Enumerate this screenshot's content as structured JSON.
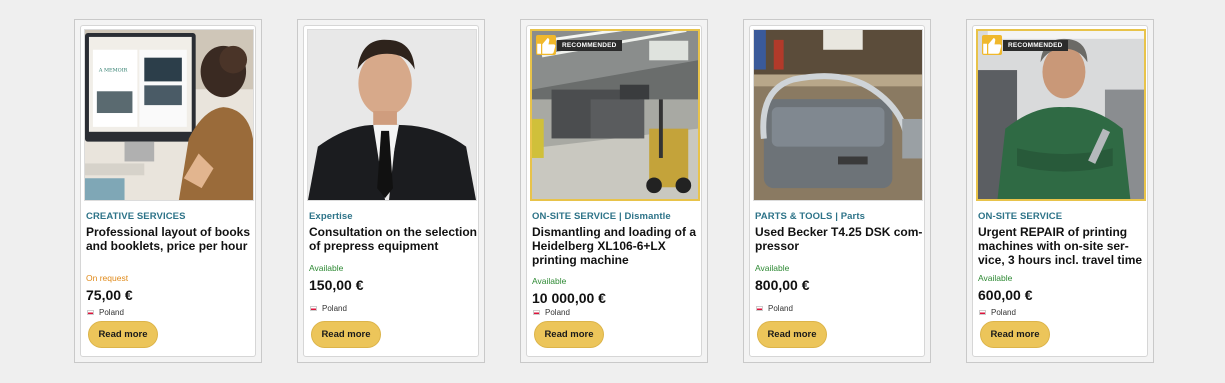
{
  "cards": [
    {
      "category": "CREATIVE SERVICES",
      "title": "Professional layout of books and booklets, price per hour",
      "availability": "On request",
      "price": "75,00 €",
      "location": "Poland",
      "button": "Read more"
    },
    {
      "category": "Expertise",
      "title": "Consultation on the selection of prepress equipment",
      "availability": "Available",
      "price": "150,00 €",
      "location": "Poland",
      "button": "Read more"
    },
    {
      "category": "ON-SITE SERVICE | Dismantle",
      "title": "Dismantling and loading of a Heidelberg XL106-6+LX printing machine",
      "availability": "Available",
      "price": "10 000,00 €",
      "location": "Poland",
      "button": "Read more",
      "badge": "RECOMMENDED"
    },
    {
      "category": "PARTS & TOOLS | Parts",
      "title": "Used Becker T4.25 DSK com-pressor",
      "availability": "Available",
      "price": "800,00 €",
      "location": "Poland",
      "button": "Read more"
    },
    {
      "category": "ON-SITE SERVICE",
      "title": "Urgent REPAIR of printing machines with on-site ser-vice, 3 hours incl. travel time",
      "availability": "Available",
      "price": "600,00 €",
      "location": "Poland",
      "button": "Read more",
      "badge": "RECOMMENDED"
    }
  ],
  "colors": {
    "category": "#2d7388",
    "on_request": "#e08a1a",
    "available": "#2e8a34",
    "button": "#ecc55a",
    "recommended_border": "#e8c34a"
  },
  "icons": {
    "badge": "thumbs-up-icon",
    "location": "poland-flag-icon"
  }
}
